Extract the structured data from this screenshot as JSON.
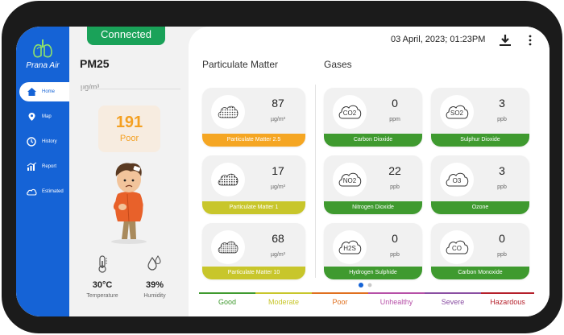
{
  "app": {
    "logo_name": "Prana Air"
  },
  "status": {
    "connected": "Connected"
  },
  "header": {
    "datetime": "03 April, 2023; 01:23PM"
  },
  "sidebar": {
    "items": [
      {
        "label": "Home",
        "icon": "home-icon",
        "active": true
      },
      {
        "label": "Map",
        "icon": "map-pin-icon",
        "active": false
      },
      {
        "label": "History",
        "icon": "clock-icon",
        "active": false
      },
      {
        "label": "Report",
        "icon": "chart-icon",
        "active": false
      },
      {
        "label": "Estimated",
        "icon": "cloud-icon",
        "active": false
      }
    ]
  },
  "left": {
    "title": "PM25",
    "unit": "µg/m³",
    "aqi_value": "191",
    "aqi_status": "Poor",
    "temperature": {
      "value": "30°C",
      "label": "Temperature"
    },
    "humidity": {
      "value": "39%",
      "label": "Humidity"
    }
  },
  "particulate": {
    "title": "Particulate Matter",
    "cards": [
      {
        "value": "87",
        "unit": "µg/m³",
        "name": "Particulate Matter 2.5",
        "color": "#f5a623"
      },
      {
        "value": "17",
        "unit": "µg/m³",
        "name": "Particulate Matter 1",
        "color": "#c8c62b"
      },
      {
        "value": "68",
        "unit": "µg/m³",
        "name": "Particulate Matter 10",
        "color": "#c8c62b"
      }
    ]
  },
  "gases": {
    "title": "Gases",
    "cards": [
      {
        "formula": "CO2",
        "value": "0",
        "unit": "ppm",
        "name": "Carbon Dioxide",
        "color": "#3f9a2f"
      },
      {
        "formula": "SO2",
        "value": "3",
        "unit": "ppb",
        "name": "Sulphur Dioxide",
        "color": "#3f9a2f"
      },
      {
        "formula": "NO2",
        "value": "22",
        "unit": "ppb",
        "name": "Nitrogen Dioxide",
        "color": "#3f9a2f"
      },
      {
        "formula": "O3",
        "value": "3",
        "unit": "ppb",
        "name": "Ozone",
        "color": "#3f9a2f"
      },
      {
        "formula": "H2S",
        "value": "0",
        "unit": "ppb",
        "name": "Hydrogen Sulphide",
        "color": "#3f9a2f"
      },
      {
        "formula": "CO",
        "value": "0",
        "unit": "ppb",
        "name": "Carbon Monoxide",
        "color": "#3f9a2f"
      }
    ]
  },
  "scale": [
    {
      "label": "Good",
      "color": "#3f9a2f"
    },
    {
      "label": "Moderate",
      "color": "#c8c62b"
    },
    {
      "label": "Poor",
      "color": "#e0701f"
    },
    {
      "label": "Unhealthy",
      "color": "#b64fa7"
    },
    {
      "label": "Severe",
      "color": "#8a4ea2"
    },
    {
      "label": "Hazardous",
      "color": "#b51f2a"
    }
  ],
  "pager": {
    "active_index": 0,
    "count": 2
  }
}
